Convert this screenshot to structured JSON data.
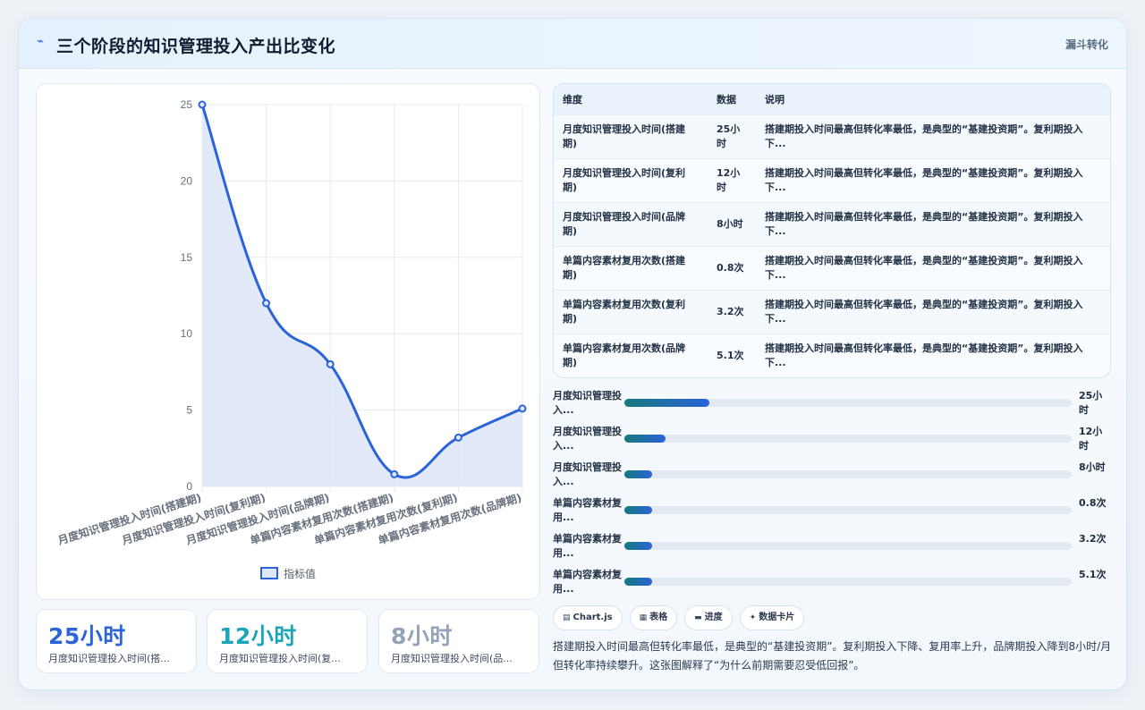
{
  "header": {
    "icon": "trend-icon",
    "title": "三个阶段的知识管理投入产出比变化",
    "tag": "漏斗转化"
  },
  "chart_data": {
    "type": "line",
    "categories": [
      "月度知识管理投入时间(搭建期)",
      "月度知识管理投入时间(复利期)",
      "月度知识管理投入时间(品牌期)",
      "单篇内容素材复用次数(搭建期)",
      "单篇内容素材复用次数(复利期)",
      "单篇内容素材复用次数(品牌期)"
    ],
    "series": [
      {
        "name": "指标值",
        "values": [
          25,
          12,
          8,
          0.8,
          3.2,
          5.1
        ]
      }
    ],
    "ylim": [
      0,
      25
    ],
    "yticks": [
      0,
      5,
      10,
      15,
      20,
      25
    ],
    "grid": true,
    "legend": "bottom",
    "colors": {
      "line": "#2b63d9",
      "fill": "#dfe7f8"
    }
  },
  "kpis": [
    {
      "value": "25小时",
      "label": "月度知识管理投入时间(搭...",
      "color": "#2b63d9"
    },
    {
      "value": "12小时",
      "label": "月度知识管理投入时间(复...",
      "color": "#1aa6b7"
    },
    {
      "value": "8小时",
      "label": "月度知识管理投入时间(品...",
      "color": "#94a3b8"
    }
  ],
  "table": {
    "headers": [
      "维度",
      "数据",
      "说明"
    ],
    "rows": [
      {
        "dim": "月度知识管理投入时间(搭建期)",
        "val": "25小时",
        "desc": "搭建期投入时间最高但转化率最低，是典型的“基建投资期”。复利期投入下..."
      },
      {
        "dim": "月度知识管理投入时间(复利期)",
        "val": "12小时",
        "desc": "搭建期投入时间最高但转化率最低，是典型的“基建投资期”。复利期投入下..."
      },
      {
        "dim": "月度知识管理投入时间(品牌期)",
        "val": "8小时",
        "desc": "搭建期投入时间最高但转化率最低，是典型的“基建投资期”。复利期投入下..."
      },
      {
        "dim": "单篇内容素材复用次数(搭建期)",
        "val": "0.8次",
        "desc": "搭建期投入时间最高但转化率最低，是典型的“基建投资期”。复利期投入下..."
      },
      {
        "dim": "单篇内容素材复用次数(复利期)",
        "val": "3.2次",
        "desc": "搭建期投入时间最高但转化率最低，是典型的“基建投资期”。复利期投入下..."
      },
      {
        "dim": "单篇内容素材复用次数(品牌期)",
        "val": "5.1次",
        "desc": "搭建期投入时间最高但转化率最低，是典型的“基建投资期”。复利期投入下..."
      }
    ]
  },
  "progress": [
    {
      "label": "月度知识管理投入...",
      "value": "25小时",
      "fraction": 0.19
    },
    {
      "label": "月度知识管理投入...",
      "value": "12小时",
      "fraction": 0.092
    },
    {
      "label": "月度知识管理投入...",
      "value": "8小时",
      "fraction": 0.062
    },
    {
      "label": "单篇内容素材复用...",
      "value": "0.8次",
      "fraction": 0.062
    },
    {
      "label": "单篇内容素材复用...",
      "value": "3.2次",
      "fraction": 0.062
    },
    {
      "label": "单篇内容素材复用...",
      "value": "5.1次",
      "fraction": 0.062
    }
  ],
  "chips": [
    {
      "icon": "chart-icon",
      "glyph": "▤",
      "label": "Chart.js"
    },
    {
      "icon": "table-icon",
      "glyph": "▦",
      "label": "表格"
    },
    {
      "icon": "progress-icon",
      "glyph": "▬",
      "label": "进度"
    },
    {
      "icon": "sparkle-icon",
      "glyph": "✦",
      "label": "数据卡片"
    }
  ],
  "summary": "搭建期投入时间最高但转化率最低，是典型的“基建投资期”。复利期投入下降、复用率上升，品牌期投入降到8小时/月但转化率持续攀升。这张图解释了“为什么前期需要忍受低回报”。"
}
